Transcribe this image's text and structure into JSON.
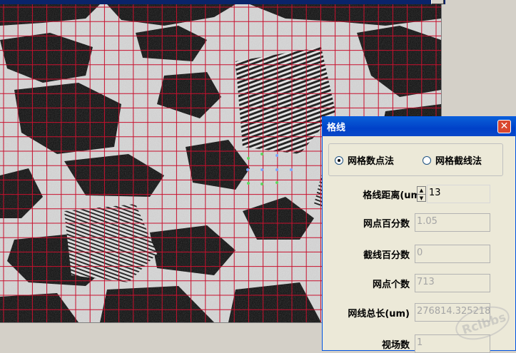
{
  "dialog": {
    "title": "格线",
    "close_symbol": "✕",
    "modes": [
      {
        "label": "网格数点法",
        "selected": true
      },
      {
        "label": "网格截线法",
        "selected": false
      }
    ],
    "fields": [
      {
        "label": "格线距离(um)",
        "value": "13",
        "enabled": true
      },
      {
        "label": "网点百分数",
        "value": "1.05",
        "enabled": false
      },
      {
        "label": "截线百分数",
        "value": "0",
        "enabled": false
      },
      {
        "label": "网点个数",
        "value": "713",
        "enabled": false
      },
      {
        "label": "网线总长(um)",
        "value": "276814.325218",
        "enabled": false
      },
      {
        "label": "视场数",
        "value": "1",
        "enabled": false
      }
    ],
    "spin_up": "▲",
    "spin_down": "▼"
  },
  "grid_color": "#c8102e",
  "watermark": "Rclbbs"
}
